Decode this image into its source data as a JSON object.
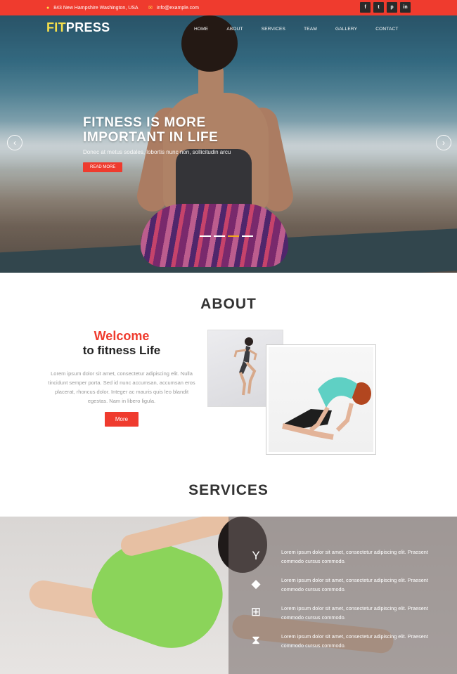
{
  "topbar": {
    "address_icon": "map-marker-icon",
    "address": "843 New Hampshire Washington, USA",
    "email_icon": "envelope-icon",
    "email": "info@example.com",
    "social": [
      {
        "name": "facebook-icon",
        "glyph": "f"
      },
      {
        "name": "twitter-icon",
        "glyph": "t"
      },
      {
        "name": "pinterest-icon",
        "glyph": "p"
      },
      {
        "name": "linkedin-icon",
        "glyph": "in"
      }
    ]
  },
  "brand": {
    "part1": "FIT",
    "part2": "PRESS"
  },
  "nav": {
    "items": [
      "HOME",
      "ABOUT",
      "SERVICES",
      "TEAM",
      "GALLERY",
      "CONTACT"
    ]
  },
  "hero": {
    "title": "FITNESS IS MORE\nIMPORTANT IN LIFE",
    "subtitle": "Donec at metus sodales, lobortis nunc non, sollicitudin arcu",
    "button": "READ MORE",
    "prev_icon": "chevron-left-icon",
    "next_icon": "chevron-right-icon",
    "slides": 4,
    "active_slide": 3
  },
  "about": {
    "title": "ABOUT",
    "welcome_line1": "Welcome",
    "welcome_line2": "to fitness Life",
    "paragraph": "Lorem ipsum dolor sit amet, consectetur adipiscing elit. Nulla tincidunt semper porta. Sed id nunc accumsan, accumsan eros placerat, rhoncus dolor. Integer ac mauris quis leo blandit egestas. Nam in libero ligula.",
    "button": "More"
  },
  "services": {
    "title": "SERVICES",
    "items": [
      {
        "icon": "yoga-glass-icon",
        "glyph": "Y",
        "text": "Lorem ipsum dolor sit amet, consectetur adipiscing elit. Praesent commodo cursus commodo."
      },
      {
        "icon": "fox-icon",
        "glyph": "◆",
        "text": "Lorem ipsum dolor sit amet, consectetur adipiscing elit. Praesent commodo cursus commodo."
      },
      {
        "icon": "sitemap-icon",
        "glyph": "⊞",
        "text": "Lorem ipsum dolor sit amet, consectetur adipiscing elit. Praesent commodo cursus commodo."
      },
      {
        "icon": "hourglass-icon",
        "glyph": "⧗",
        "text": "Lorem ipsum dolor sit amet, consectetur adipiscing elit. Praesent commodo cursus commodo."
      }
    ]
  },
  "colors": {
    "accent": "#ef3b2e",
    "logo_yellow": "#f6e04b"
  }
}
